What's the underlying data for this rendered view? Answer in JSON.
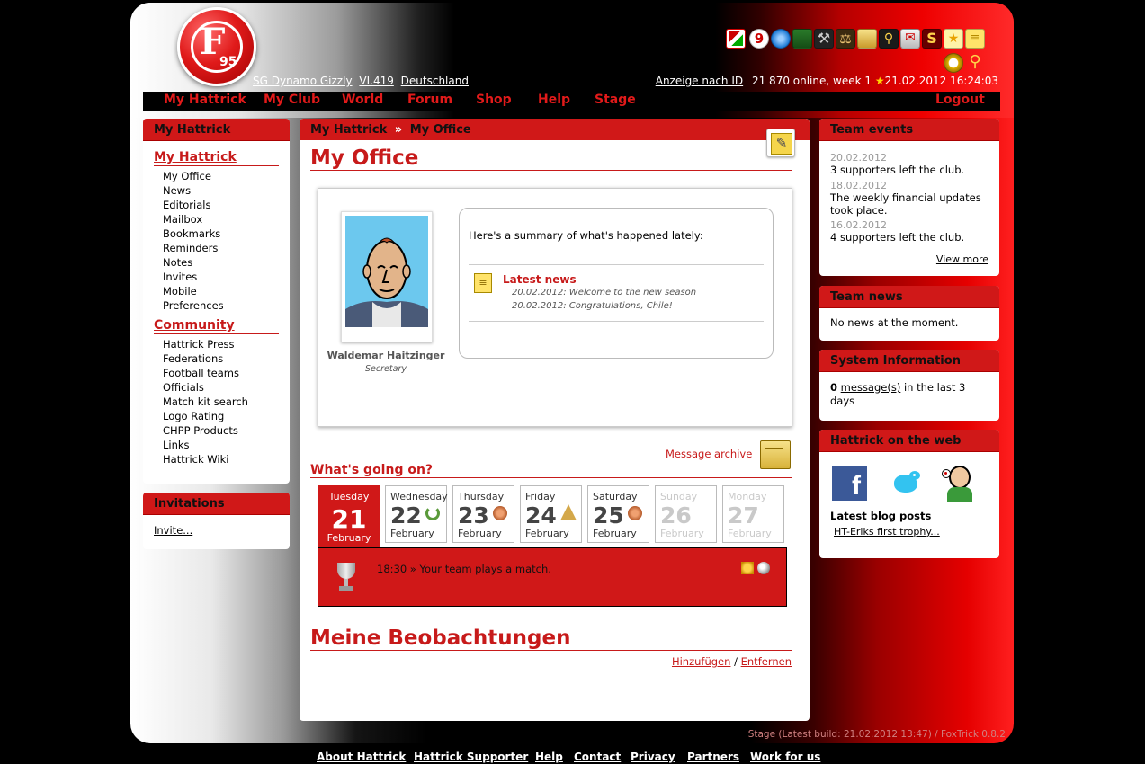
{
  "header": {
    "team_name": "SG Dynamo Gizzly",
    "league": "VI.419",
    "country": "Deutschland",
    "id_link": "Anzeige nach ID",
    "online_status": "21 870 online, week 1",
    "datetime": "21.02.2012 16:24:03",
    "logo_text": "95"
  },
  "nav": [
    "My Hattrick",
    "My Club",
    "World",
    "Forum",
    "Shop",
    "Help",
    "Stage",
    "Logout"
  ],
  "left": {
    "box_title": "My Hattrick",
    "section1_title": "My Hattrick",
    "section1_items": [
      "My Office",
      "News",
      "Editorials",
      "Mailbox",
      "Bookmarks",
      "Reminders",
      "Notes",
      "Invites",
      "Mobile",
      "Preferences"
    ],
    "section2_title": "Community",
    "section2_items": [
      "Hattrick Press",
      "Federations",
      "Football teams",
      "Officials",
      "Match kit search",
      "Logo Rating",
      "CHPP Products",
      "Links",
      "Hattrick Wiki"
    ],
    "invite_title": "Invitations",
    "invite_link": "Invite..."
  },
  "main": {
    "crumb1": "My Hattrick",
    "crumb_sep": "»",
    "crumb2": "My Office",
    "title": "My Office",
    "secretary_name": "Waldemar Haitzinger",
    "secretary_role": "Secretary",
    "summary": "Here's a summary of what's happened lately:",
    "news_title": "Latest news",
    "news": [
      "20.02.2012: Welcome to the new season",
      "20.02.2012: Congratulations, Chile!"
    ],
    "archive_link": "Message archive",
    "going_on_title": "What's going on?",
    "days": [
      {
        "name": "Tuesday",
        "num": "21",
        "month": "February"
      },
      {
        "name": "Wednesday",
        "num": "22",
        "month": "February"
      },
      {
        "name": "Thursday",
        "num": "23",
        "month": "February"
      },
      {
        "name": "Friday",
        "num": "24",
        "month": "February"
      },
      {
        "name": "Saturday",
        "num": "25",
        "month": "February"
      },
      {
        "name": "Sunday",
        "num": "26",
        "month": "February"
      },
      {
        "name": "Monday",
        "num": "27",
        "month": "February"
      }
    ],
    "event_text": "18:30 » Your team plays a match.",
    "watch_title": "Meine Beobachtungen",
    "watch_add": "Hinzufügen",
    "watch_sep": "/",
    "watch_remove": "Entfernen"
  },
  "right": {
    "events_title": "Team events",
    "events": [
      {
        "date": "20.02.2012",
        "text": "3 supporters left the club."
      },
      {
        "date": "18.02.2012",
        "text": "The weekly financial updates took place."
      },
      {
        "date": "16.02.2012",
        "text": "4 supporters left the club."
      }
    ],
    "view_more": "View more",
    "news_title": "Team news",
    "news_text": "No news at the moment.",
    "sys_title": "System Information",
    "sys_count": "0",
    "sys_link": "message(s)",
    "sys_rest": "in the last 3 days",
    "web_title": "Hattrick on the web",
    "blog_title": "Latest blog posts",
    "blog_link": "HT-Eriks first trophy..."
  },
  "stage_info": "Stage (Latest build: 21.02.2012 13:47) / FoxTrick 0.8.2",
  "footer": [
    "About Hattrick",
    "Hattrick Supporter",
    "Help",
    "Contact",
    "Privacy",
    "Partners",
    "Work for us"
  ],
  "colors": {
    "accent": "#d01818",
    "title_red": "#c71a1a"
  }
}
